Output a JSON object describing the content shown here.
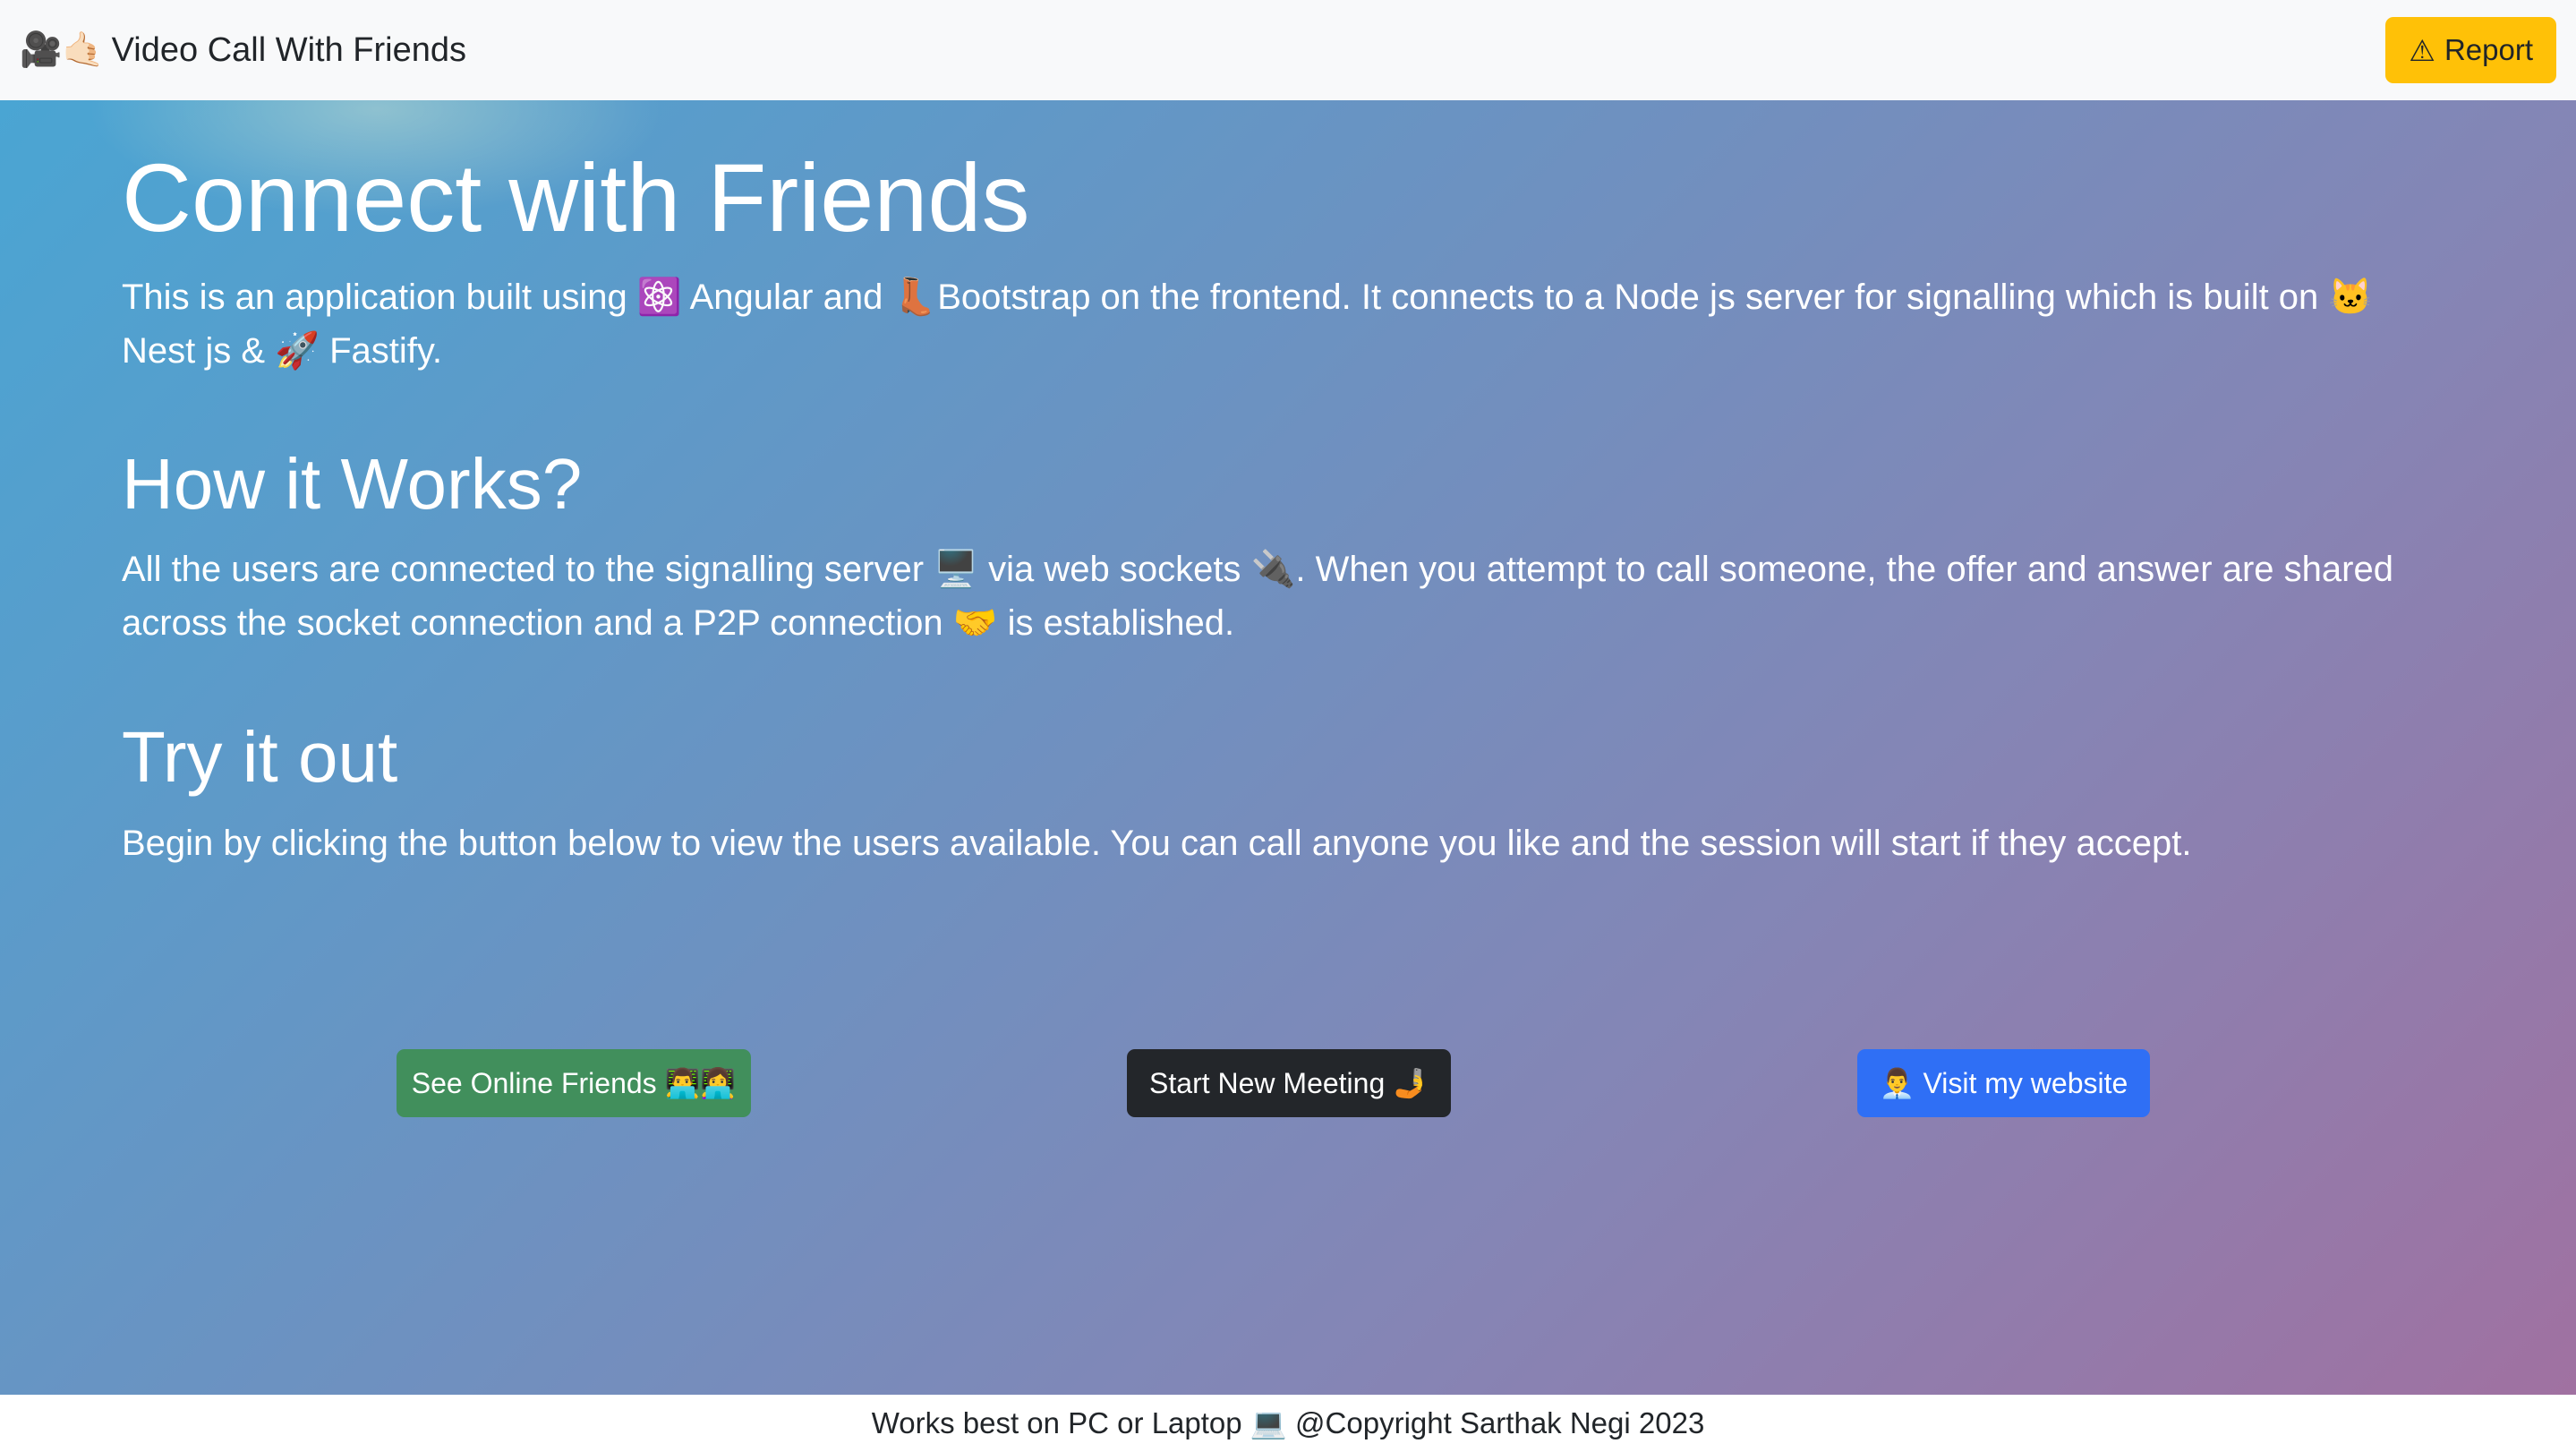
{
  "navbar": {
    "brand_icons": "🎥🤙🏻",
    "brand_title": "Video Call With Friends",
    "report_icon": "⚠",
    "report_label": "Report"
  },
  "hero": {
    "title": "Connect with Friends",
    "intro": "This is an application built using ⚛️ Angular and 👢Bootstrap on the frontend. It connects to a Node js server for signalling which is built on 🐱 Nest js & 🚀 Fastify.",
    "how_title": "How it Works?",
    "how_text": "All the users are connected to the signalling server 🖥️ via web sockets 🔌. When you attempt to call someone, the offer and answer are shared across the socket connection and a P2P connection 🤝 is established.",
    "try_title": "Try it out",
    "try_text": "Begin by clicking the button below to view the users available. You can call anyone you like and the session will start if they accept."
  },
  "actions": {
    "online_friends_label": "See Online Friends 👨‍💻👩‍💻",
    "new_meeting_label": "Start New Meeting 🤳",
    "website_label": "👨‍💼 Visit my website"
  },
  "footer": {
    "text": "Works best on PC or Laptop 💻 @Copyright Sarthak Negi 2023"
  },
  "colors": {
    "navbar_bg": "#f8f9fa",
    "report_bg": "#ffc107",
    "success_bg": "#418f5c",
    "dark_bg": "#23262a",
    "primary_bg": "#2f6ff5",
    "hero_gradient_start": "#4aa5d3",
    "hero_gradient_end": "#a071a1"
  }
}
